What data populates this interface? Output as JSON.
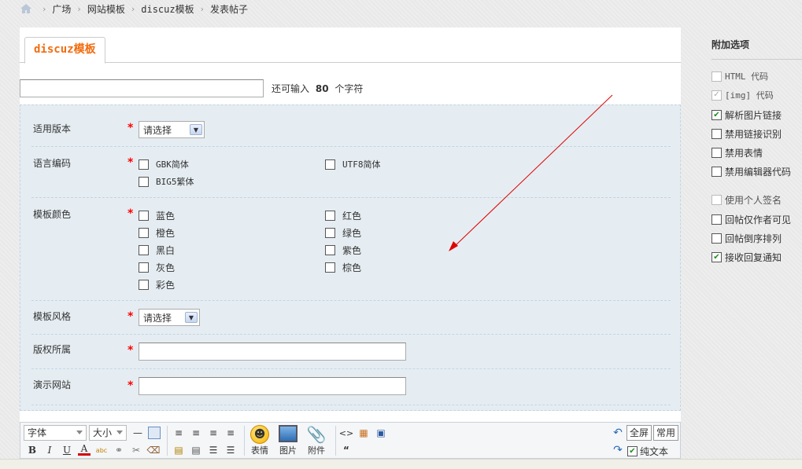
{
  "breadcrumb": {
    "items": [
      "广场",
      "网站模板",
      "discuz模板",
      "发表帖子"
    ]
  },
  "tab": {
    "label": "discuz模板"
  },
  "title_hint": {
    "prefix": "还可输入",
    "count": "80",
    "suffix": "个字符"
  },
  "form": {
    "version": {
      "label": "适用版本",
      "value": "请选择"
    },
    "encoding": {
      "label": "语言编码",
      "options": [
        "GBK简体",
        "UTF8简体",
        "BIG5繁体"
      ]
    },
    "color": {
      "label": "模板颜色",
      "options": [
        "蓝色",
        "红色",
        "橙色",
        "绿色",
        "黑白",
        "紫色",
        "灰色",
        "棕色",
        "彩色"
      ]
    },
    "style": {
      "label": "模板风格",
      "value": "请选择"
    },
    "copyright": {
      "label": "版权所属",
      "value": ""
    },
    "demo": {
      "label": "演示网站",
      "value": ""
    }
  },
  "sidebar": {
    "title": "附加选项",
    "options": [
      {
        "label": "HTML 代码",
        "checked": false,
        "disabled": true
      },
      {
        "label": "[img] 代码",
        "checked": true,
        "disabled": true
      },
      {
        "label": "解析图片链接",
        "checked": true,
        "disabled": false
      },
      {
        "label": "禁用链接识别",
        "checked": false,
        "disabled": false
      },
      {
        "label": "禁用表情",
        "checked": false,
        "disabled": false
      },
      {
        "label": "禁用编辑器代码",
        "checked": false,
        "disabled": false
      },
      {
        "label": "使用个人签名",
        "checked": false,
        "disabled": true
      },
      {
        "label": "回帖仅作者可见",
        "checked": false,
        "disabled": false
      },
      {
        "label": "回帖倒序排列",
        "checked": false,
        "disabled": false
      },
      {
        "label": "接收回复通知",
        "checked": true,
        "disabled": false
      }
    ]
  },
  "editor": {
    "font_label": "字体",
    "size_label": "大小",
    "smiley_label": "表情",
    "image_label": "图片",
    "attach_label": "附件",
    "fullscreen_label": "全屏",
    "common_label": "常用",
    "plaintext_label": "纯文本",
    "plaintext_checked": true,
    "font_color": "#d40000",
    "bold_label": "B",
    "italic_label": "I",
    "underline_label": "U",
    "fontcolor_label": "A",
    "spell_label": "abc"
  },
  "colors": {
    "tab_text": "#f26c0f",
    "form_bg": "#e5edf2",
    "required": "#ff0000",
    "arrow": "#e00000"
  }
}
